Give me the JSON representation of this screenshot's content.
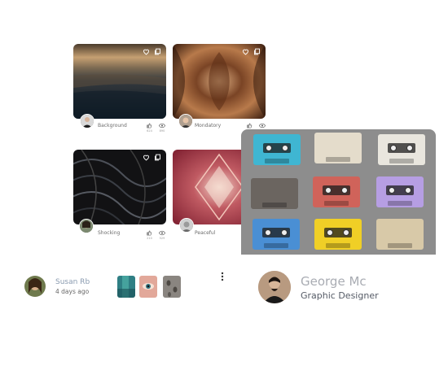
{
  "cards": [
    {
      "label": "Background",
      "likes": "624",
      "views": "890"
    },
    {
      "label": "Mondatory"
    },
    {
      "label": "Shocking",
      "likes": "210",
      "views": "529"
    },
    {
      "label": "Peaceful"
    }
  ],
  "post": {
    "author": "Susan Rb",
    "time": "4 days ago"
  },
  "profile": {
    "name": "George Mc",
    "role": "Graphic Designer"
  },
  "colors": {
    "accent_muted": "#8a9bb0",
    "cassette_bg": "#8d8d8d"
  },
  "icons": [
    "heart-icon",
    "copy-icon",
    "thumb-up-icon",
    "eye-icon",
    "more-vertical-icon"
  ]
}
